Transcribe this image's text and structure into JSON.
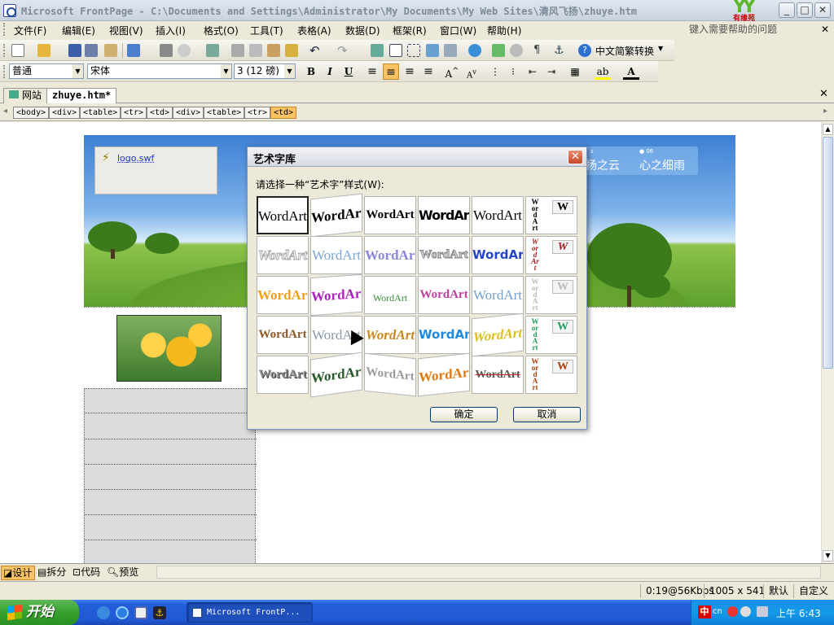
{
  "window": {
    "title": "Microsoft FrontPage - C:\\Documents and Settings\\Administrator\\My Documents\\My Web Sites\\清风飞扬\\zhuye.htm",
    "logo_text": "YY",
    "logo_sub": "有缘苑",
    "minimize": "_",
    "maximize": "□",
    "close": "✕"
  },
  "menu": {
    "items": [
      "文件(F)",
      "编辑(E)",
      "视图(V)",
      "插入(I)",
      "格式(O)",
      "工具(T)",
      "表格(A)",
      "数据(D)",
      "框架(R)",
      "窗口(W)",
      "帮助(H)"
    ],
    "help_placeholder": "键入需要帮助的问题",
    "close_doc": "✕"
  },
  "toolbar1": {
    "convert_label": "中文简繁转换"
  },
  "toolbar2": {
    "style_value": "普通",
    "font_value": "宋体",
    "size_value": "3 (12 磅)",
    "bold": "B",
    "italic": "I",
    "underline": "U"
  },
  "tabs": {
    "website": "网站",
    "doc": "zhuye.htm*",
    "close": "✕"
  },
  "tags": [
    "<body>",
    "<div>",
    "<table>",
    "<tr>",
    "<td>",
    "<div>",
    "<table>",
    "<tr>",
    "<td>"
  ],
  "editor": {
    "swf_label": "logo.swf",
    "nav_link1": "扬之云",
    "nav_link2": "心之细雨",
    "nav_small1": "s",
    "nav_small2": "● 06"
  },
  "dialog": {
    "title": "艺术字库",
    "prompt": "请选择一种“艺术字”样式(W):",
    "ok": "确定",
    "cancel": "取消",
    "cell_text": "WordArt",
    "vertical_text": "WordArt",
    "w_letter": "W"
  },
  "view_tabs": [
    "设计",
    "拆分",
    "代码",
    "预览"
  ],
  "status": {
    "speed": "0:19@56Kbps",
    "size": "1005 x 541",
    "default": "默认",
    "custom": "自定义"
  },
  "taskbar": {
    "start": "开始",
    "task_item": "Microsoft FrontP...",
    "clock": "上午 6:43",
    "ime": "中",
    "lang": "cn"
  }
}
